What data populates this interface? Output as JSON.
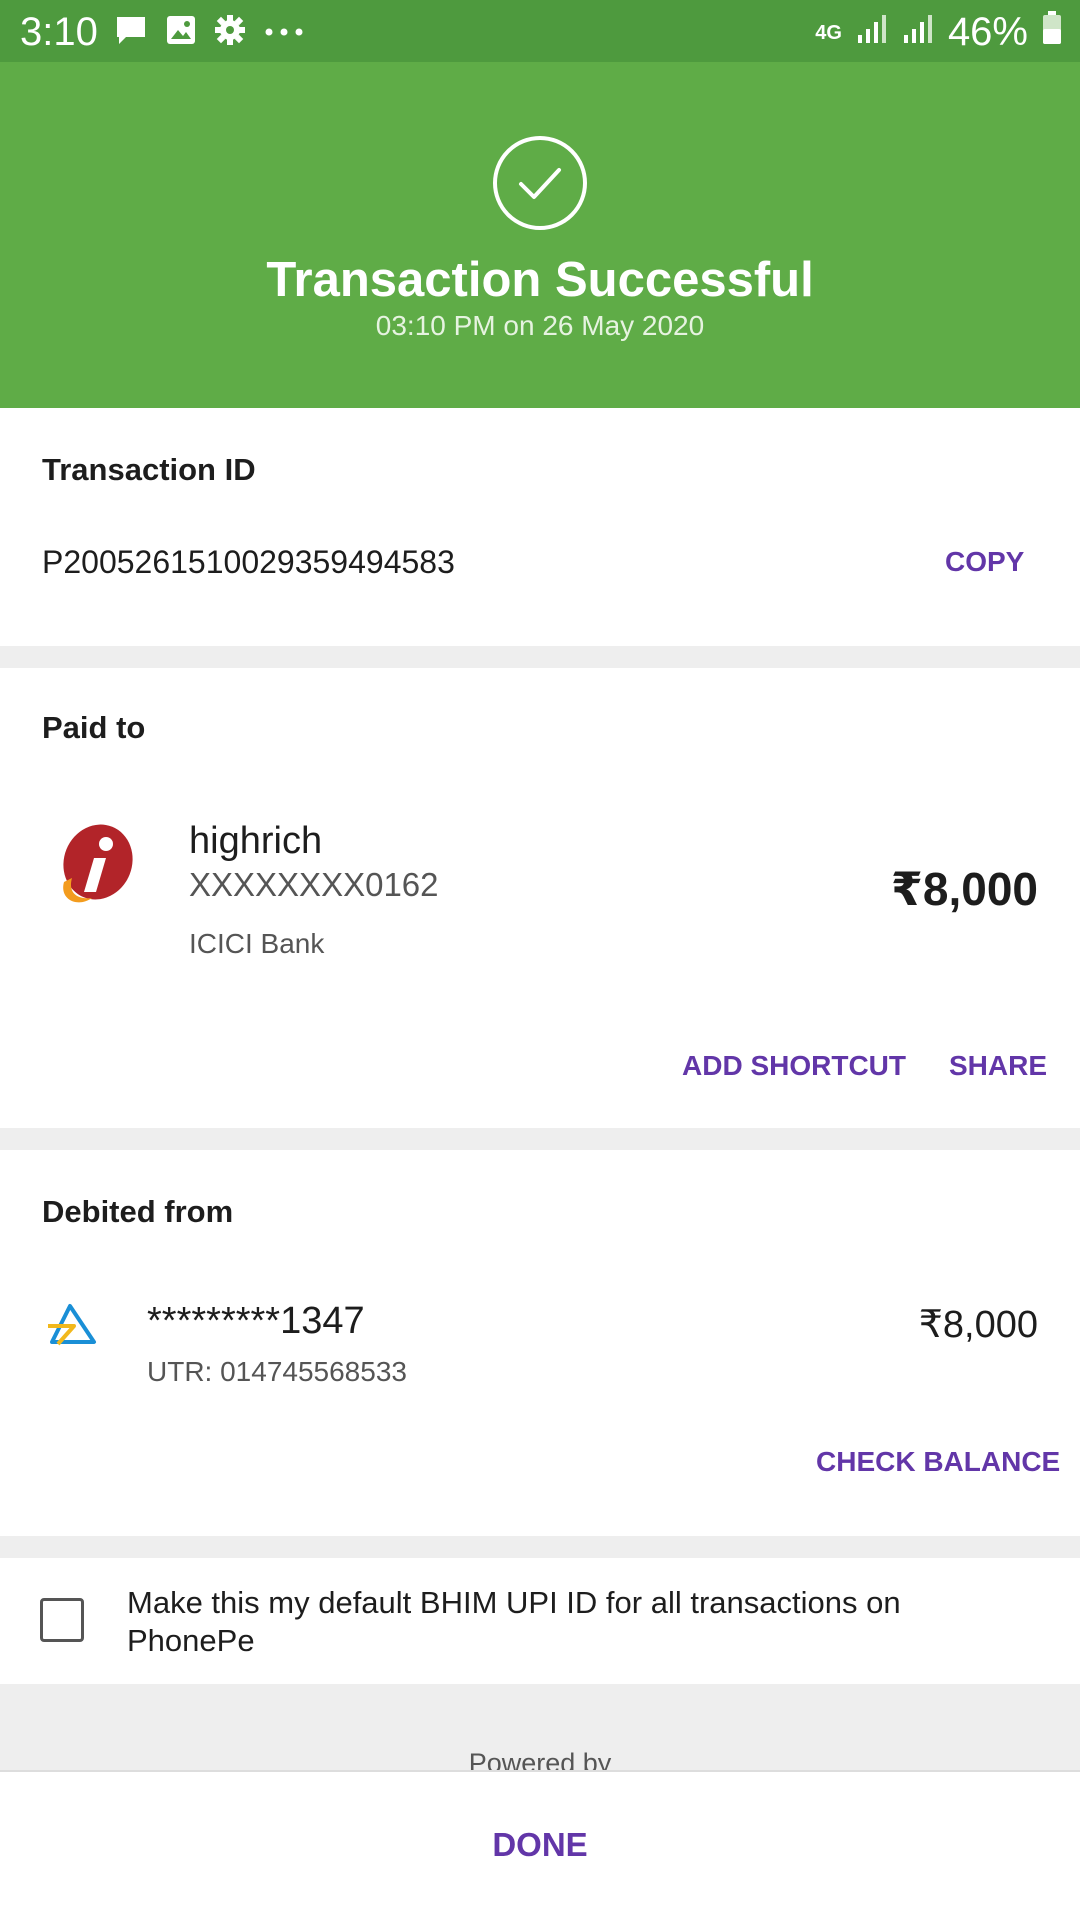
{
  "status_bar": {
    "time": "3:10",
    "network": "4G",
    "battery": "46%",
    "icons": [
      "chat-icon",
      "image-icon",
      "gear-icon",
      "more-dots-icon",
      "signal-icon",
      "battery-icon"
    ]
  },
  "header": {
    "title": "Transaction Successful",
    "subtitle": "03:10 PM on 26 May 2020",
    "accent": "#5fac47"
  },
  "transaction": {
    "label": "Transaction ID",
    "id": "P2005261510029359494583",
    "copy_label": "COPY"
  },
  "paid_to": {
    "label": "Paid to",
    "name": "highrich",
    "account": "XXXXXXXX0162",
    "bank": "ICICI Bank",
    "amount": "₹8,000",
    "add_shortcut_label": "ADD SHORTCUT",
    "share_label": "SHARE",
    "logo": "icici-bank-logo"
  },
  "debited_from": {
    "label": "Debited from",
    "account": "*********1347",
    "utr": "UTR: 014745568533",
    "amount": "₹8,000",
    "check_balance_label": "CHECK BALANCE",
    "logo": "sbi-bank-logo"
  },
  "default_option": {
    "text": "Make this my default BHIM UPI ID for all transactions on PhonePe",
    "checked": false
  },
  "footer": {
    "powered_by": "Powered by",
    "done_label": "DONE"
  },
  "colors": {
    "primary_purple": "#6236a8",
    "success_green": "#5fac47",
    "status_green": "#4e9a3e"
  }
}
